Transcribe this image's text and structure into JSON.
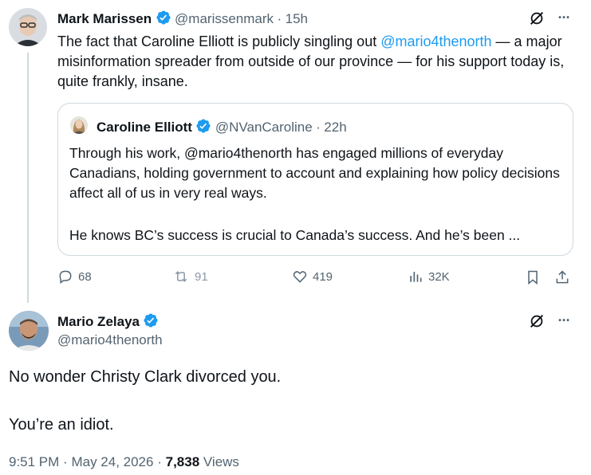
{
  "tweet1": {
    "name": "Mark Marissen",
    "handle": "@marissenmark",
    "dot": "·",
    "time": "15h",
    "text_before": "The fact that Caroline Elliott is publicly singling out ",
    "mention": "@mario4thenorth",
    "text_after": " — a major misinformation spreader from outside of our province — for his support today is, quite frankly, insane.",
    "more": "···"
  },
  "quote": {
    "name": "Caroline Elliott",
    "handle": "@NVanCaroline",
    "dot": "·",
    "time": "22h",
    "para1": "Through his work, @mario4thenorth has engaged millions of everyday Canadians, holding government to account and explaining how policy decisions affect all of us in very real ways.",
    "para2": "He knows BC’s success is crucial to Canada’s success. And he’s been ..."
  },
  "actions": {
    "replies": "68",
    "reposts": "91",
    "likes": "419",
    "views": "32K"
  },
  "tweet2": {
    "name": "Mario Zelaya",
    "handle": "@mario4thenorth",
    "line1": "No wonder Christy Clark divorced you.",
    "line2": "You’re an idiot.",
    "time": "9:51 PM",
    "date": "May 24, 2026",
    "views_count": "7,838",
    "views_label": "Views",
    "sep": "·",
    "more": "···"
  },
  "colors": {
    "verified": "#1d9bf0",
    "link": "#1d9bf0",
    "muted": "#536471",
    "border": "#cfd9de"
  }
}
